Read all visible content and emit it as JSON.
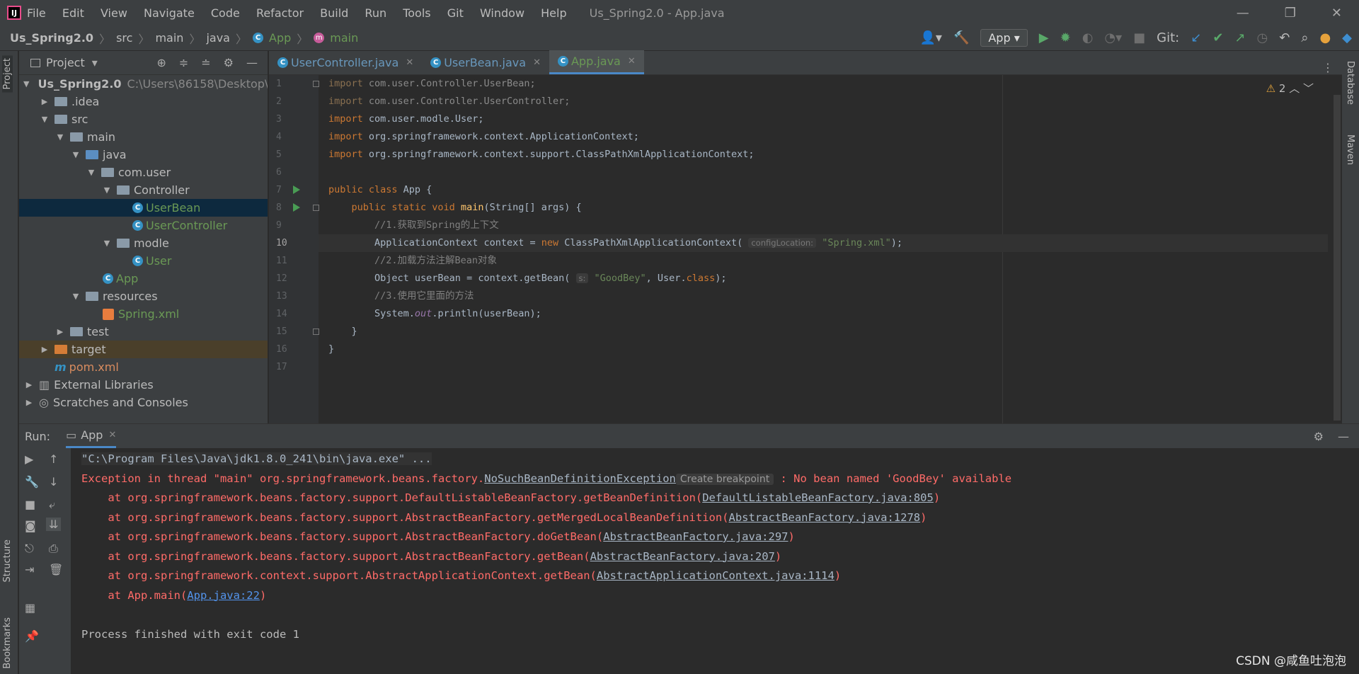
{
  "window": {
    "title": "Us_Spring2.0 - App.java",
    "logo": "IJ"
  },
  "menu": [
    "File",
    "Edit",
    "View",
    "Navigate",
    "Code",
    "Refactor",
    "Build",
    "Run",
    "Tools",
    "Git",
    "Window",
    "Help"
  ],
  "breadcrumb": [
    "Us_Spring2.0",
    "src",
    "main",
    "java",
    "App",
    "main"
  ],
  "toolbar": {
    "run_config": "App",
    "git_label": "Git:"
  },
  "project": {
    "header": "Project",
    "root": "Us_Spring2.0",
    "root_path": "C:\\Users\\86158\\Desktop\\S",
    "items": [
      ".idea",
      "src",
      "main",
      "java",
      "com.user",
      "Controller",
      "UserBean",
      "UserController",
      "modle",
      "User",
      "App",
      "resources",
      "Spring.xml",
      "test",
      "target",
      "pom.xml",
      "External Libraries",
      "Scratches and Consoles"
    ]
  },
  "tabs": [
    "UserController.java",
    "UserBean.java",
    "App.java"
  ],
  "editor": {
    "warnings": "2",
    "line_numbers": [
      "1",
      "2",
      "3",
      "4",
      "5",
      "6",
      "7",
      "8",
      "9",
      "10",
      "11",
      "12",
      "13",
      "14",
      "15",
      "16",
      "17"
    ],
    "hint_config": "configLocation:",
    "hint_s": "s:"
  },
  "left_strip": {
    "project": "Project",
    "structure": "Structure",
    "bookmarks": "Bookmarks"
  },
  "right_strip": {
    "database": "Database",
    "maven": "Maven"
  },
  "run": {
    "label": "Run:",
    "tab": "App",
    "cmd": "\"C:\\Program Files\\Java\\jdk1.8.0_241\\bin\\java.exe\" ...",
    "exc_prefix": "Exception in thread \"main\" org.springframework.beans.factory.",
    "exc_class": "NoSuchBeanDefinitionException",
    "create_bp": "Create breakpoint",
    "exc_msg": " : No bean named 'GoodBey' available",
    "stack": [
      {
        "pre": "    at org.springframework.beans.factory.support.DefaultListableBeanFactory.getBeanDefinition(",
        "link": "DefaultListableBeanFactory.java:805",
        "post": ")"
      },
      {
        "pre": "    at org.springframework.beans.factory.support.AbstractBeanFactory.getMergedLocalBeanDefinition(",
        "link": "AbstractBeanFactory.java:1278",
        "post": ")"
      },
      {
        "pre": "    at org.springframework.beans.factory.support.AbstractBeanFactory.doGetBean(",
        "link": "AbstractBeanFactory.java:297",
        "post": ")"
      },
      {
        "pre": "    at org.springframework.beans.factory.support.AbstractBeanFactory.getBean(",
        "link": "AbstractBeanFactory.java:207",
        "post": ")"
      },
      {
        "pre": "    at org.springframework.context.support.AbstractApplicationContext.getBean(",
        "link": "AbstractApplicationContext.java:1114",
        "post": ")"
      },
      {
        "pre": "    at App.main(",
        "link": "App.java:22",
        "post": ")"
      }
    ],
    "finish": "Process finished with exit code 1"
  },
  "watermark": "CSDN @咸鱼吐泡泡"
}
